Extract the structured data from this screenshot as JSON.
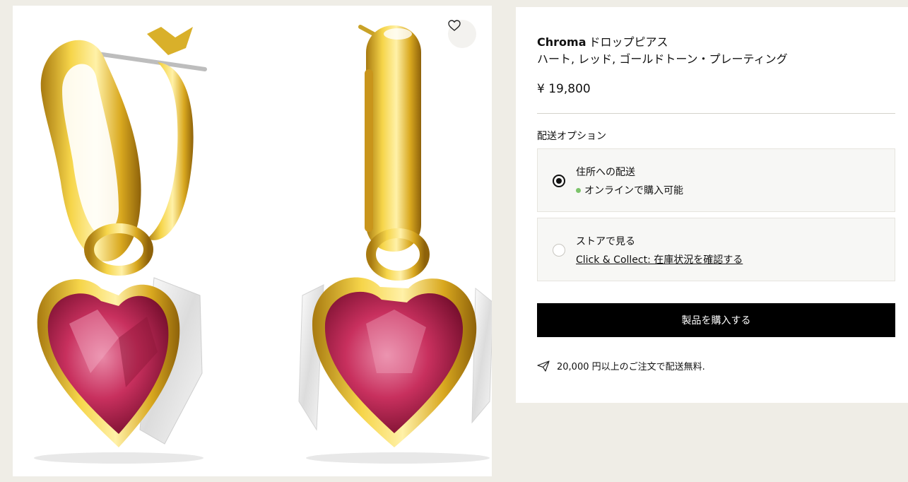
{
  "product": {
    "brand": "Chroma",
    "name": "ドロップピアス",
    "variant": "ハート, レッド, ゴールドトーン・プレーティング",
    "price": "¥ 19,800"
  },
  "shipping": {
    "heading": "配送オプション",
    "options": [
      {
        "title": "住所への配送",
        "status": "オンラインで購入可能",
        "status_color": "#7cc36a",
        "selected": true
      },
      {
        "title": "ストアで見る",
        "link": "Click & Collect: 在庫状況を確認する",
        "selected": false
      }
    ]
  },
  "actions": {
    "buy_label": "製品を購入する"
  },
  "promo": {
    "free_shipping": "20,000 円以上のご注文で配送無料.",
    "icon": "paper-plane-icon"
  },
  "icons": {
    "wishlist": "heart-outline-icon"
  },
  "colors": {
    "background": "#efede6",
    "button": "#000000",
    "gold": "#e2b92b",
    "gem": "#c12a52"
  }
}
